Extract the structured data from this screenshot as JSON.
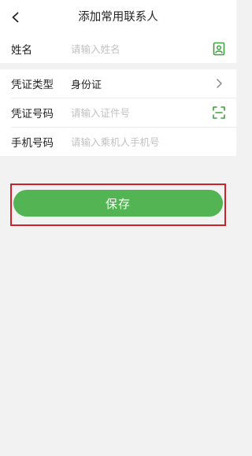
{
  "header": {
    "title": "添加常用联系人",
    "back_icon": "chevron-left-icon"
  },
  "form": {
    "name": {
      "label": "姓名",
      "placeholder": "请输入姓名",
      "icon": "contact-book-icon"
    },
    "id_type": {
      "label": "凭证类型",
      "value": "身份证",
      "icon": "chevron-right-icon"
    },
    "id_number": {
      "label": "凭证号码",
      "placeholder": "请输入证件号",
      "icon": "scan-icon"
    },
    "phone": {
      "label": "手机号码",
      "placeholder": "请输入乘机人手机号"
    }
  },
  "actions": {
    "save_label": "保存"
  },
  "colors": {
    "accent": "#52b452",
    "highlight": "#d0202a"
  }
}
